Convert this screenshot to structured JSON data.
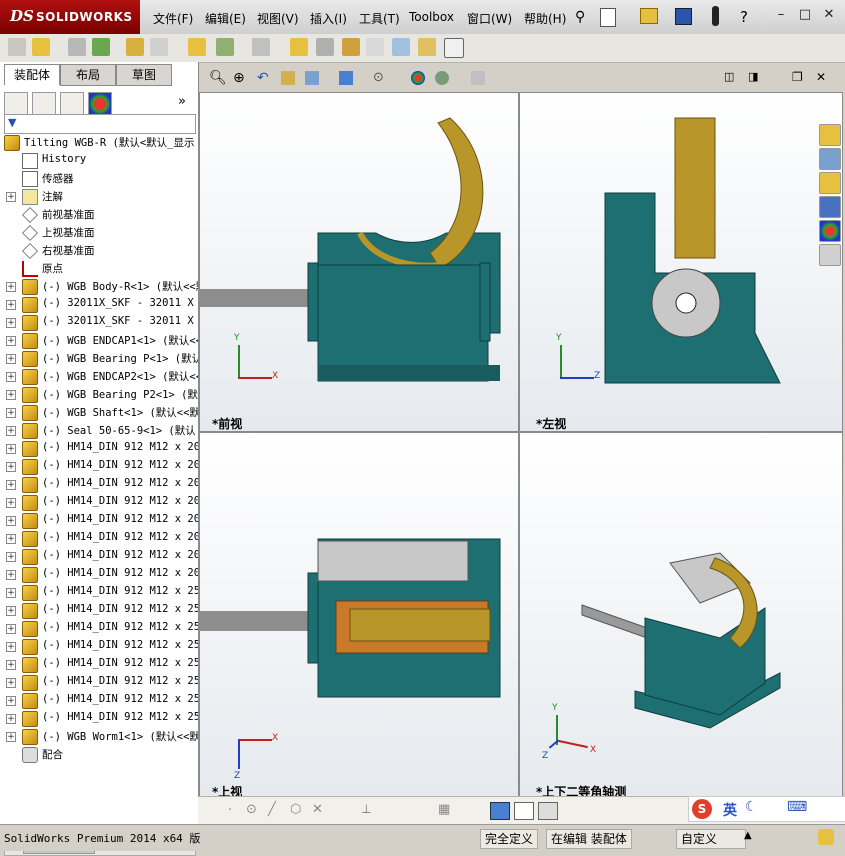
{
  "app": {
    "brand": "SOLIDWORKS",
    "brand_prefix": "DS"
  },
  "menu": [
    "文件(F)",
    "编辑(E)",
    "视图(V)",
    "插入(I)",
    "工具(T)",
    "Toolbox",
    "窗口(W)",
    "帮助(H)"
  ],
  "panel_tabs": [
    "装配体",
    "布局",
    "草图"
  ],
  "tree": {
    "root": "Tilting WGB-R  (默认<默认_显示",
    "items": [
      {
        "label": "History",
        "icon": "history-icon",
        "expand": false
      },
      {
        "label": "传感器",
        "icon": "sensor-icon",
        "expand": false
      },
      {
        "label": "注解",
        "icon": "annotation-icon",
        "expand": true
      },
      {
        "label": "前视基准面",
        "icon": "plane-icon",
        "expand": false
      },
      {
        "label": "上视基准面",
        "icon": "plane-icon",
        "expand": false
      },
      {
        "label": "右视基准面",
        "icon": "plane-icon",
        "expand": false
      },
      {
        "label": "原点",
        "icon": "origin-icon",
        "expand": false
      },
      {
        "label": "(-) WGB Body-R<1> (默认<<默",
        "icon": "part-icon",
        "expand": true
      },
      {
        "label": "(-) 32011X_SKF - 32011 X -",
        "icon": "part-icon",
        "expand": true
      },
      {
        "label": "(-) 32011X_SKF - 32011 X -",
        "icon": "part-icon",
        "expand": true
      },
      {
        "label": "(-) WGB ENDCAP1<1> (默认<<",
        "icon": "part-icon",
        "expand": true
      },
      {
        "label": "(-) WGB Bearing P<1> (默认",
        "icon": "part-icon",
        "expand": true
      },
      {
        "label": "(-) WGB ENDCAP2<1> (默认<<",
        "icon": "part-icon",
        "expand": true
      },
      {
        "label": "(-) WGB Bearing P2<1> (默认",
        "icon": "part-icon",
        "expand": true
      },
      {
        "label": "(-) WGB Shaft<1> (默认<<默",
        "icon": "part-icon",
        "expand": true
      },
      {
        "label": "(-) Seal 50-65-9<1> (默认",
        "icon": "part-icon",
        "expand": true
      },
      {
        "label": "(-) HM14_DIN 912 M12 x 20",
        "icon": "part-icon",
        "expand": true
      },
      {
        "label": "(-) HM14_DIN 912 M12 x 20",
        "icon": "part-icon",
        "expand": true
      },
      {
        "label": "(-) HM14_DIN 912 M12 x 20",
        "icon": "part-icon",
        "expand": true
      },
      {
        "label": "(-) HM14_DIN 912 M12 x 20",
        "icon": "part-icon",
        "expand": true
      },
      {
        "label": "(-) HM14_DIN 912 M12 x 20",
        "icon": "part-icon",
        "expand": true
      },
      {
        "label": "(-) HM14_DIN 912 M12 x 20",
        "icon": "part-icon",
        "expand": true
      },
      {
        "label": "(-) HM14_DIN 912 M12 x 20",
        "icon": "part-icon",
        "expand": true
      },
      {
        "label": "(-) HM14_DIN 912 M12 x 20",
        "icon": "part-icon",
        "expand": true
      },
      {
        "label": "(-) HM14_DIN 912 M12 x 25",
        "icon": "part-icon",
        "expand": true
      },
      {
        "label": "(-) HM14_DIN 912 M12 x 25",
        "icon": "part-icon",
        "expand": true
      },
      {
        "label": "(-) HM14_DIN 912 M12 x 25",
        "icon": "part-icon",
        "expand": true
      },
      {
        "label": "(-) HM14_DIN 912 M12 x 25",
        "icon": "part-icon",
        "expand": true
      },
      {
        "label": "(-) HM14_DIN 912 M12 x 25",
        "icon": "part-icon",
        "expand": true
      },
      {
        "label": "(-) HM14_DIN 912 M12 x 25",
        "icon": "part-icon",
        "expand": true
      },
      {
        "label": "(-) HM14_DIN 912 M12 x 25",
        "icon": "part-icon",
        "expand": true
      },
      {
        "label": "(-) HM14_DIN 912 M12 x 25",
        "icon": "part-icon",
        "expand": true
      },
      {
        "label": "(-) WGB Worm1<1> (默认<<默",
        "icon": "part-icon",
        "expand": true
      },
      {
        "label": "配合",
        "icon": "mate-icon",
        "expand": false
      }
    ]
  },
  "viewports": {
    "front": "*前视",
    "left": "*左视",
    "top": "*上视",
    "iso": "*上下二等角轴测"
  },
  "axes": {
    "x": "X",
    "y": "Y",
    "z": "Z"
  },
  "status": {
    "version": "SolidWorks Premium 2014 x64 版",
    "definition": "完全定义",
    "mode": "在编辑 装配体",
    "units": "自定义"
  },
  "ime": {
    "lang": "英"
  },
  "colors": {
    "housing": "#1d6f72",
    "gear": "#b8962a",
    "shaft": "#9a9a9a",
    "brand_red": "#9a0c0c"
  }
}
